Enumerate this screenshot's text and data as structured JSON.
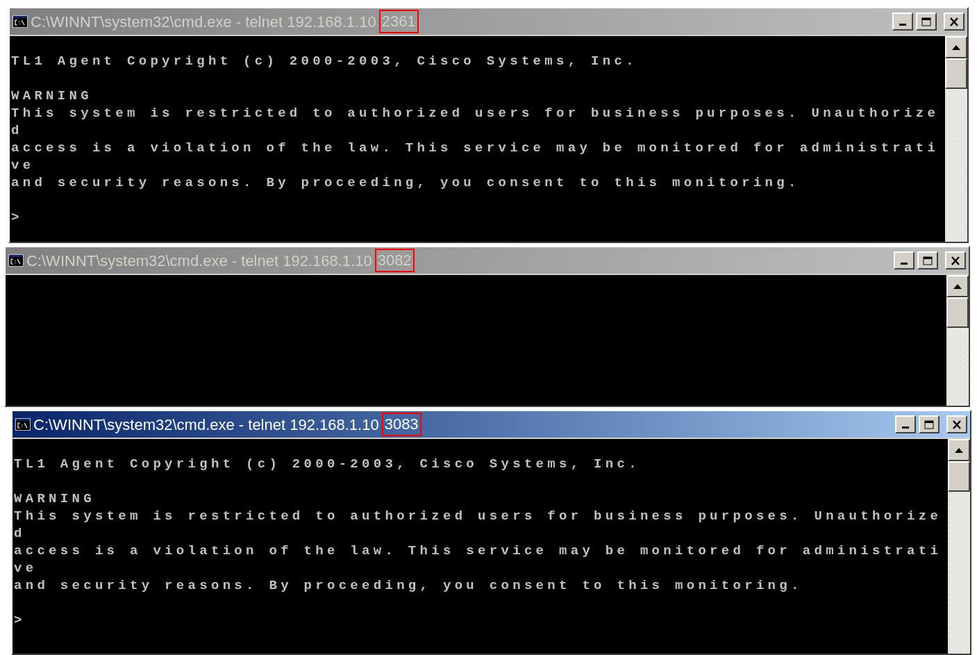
{
  "windows": [
    {
      "title": "C:\\WINNT\\system32\\cmd.exe - telnet 192.168.1.10",
      "port": "2361",
      "active": false,
      "paragraphs": [
        [
          "TL1 Agent Copyright (c) 2000-2003, Cisco Systems, Inc."
        ],
        [
          "WARNING",
          "This system is restricted to authorized users for business purposes. Unauthorize",
          "d",
          "access is a violation of the law. This service may be monitored for administrati",
          "ve",
          "and security reasons. By proceeding, you consent to this monitoring."
        ],
        [
          ">"
        ]
      ]
    },
    {
      "title": "C:\\WINNT\\system32\\cmd.exe - telnet 192.168.1.10",
      "port": "3082",
      "active": false
    },
    {
      "title": "C:\\WINNT\\system32\\cmd.exe - telnet 192.168.1.10",
      "port": "3083",
      "active": true,
      "paragraphs": [
        [
          "TL1 Agent Copyright (c) 2000-2003, Cisco Systems, Inc."
        ],
        [
          "WARNING",
          "This system is restricted to authorized users for business purposes. Unauthorize",
          "d",
          "access is a violation of the law. This service may be monitored for administrati",
          "ve",
          "and security reasons. By proceeding, you consent to this monitoring."
        ],
        [
          ">"
        ]
      ]
    }
  ]
}
